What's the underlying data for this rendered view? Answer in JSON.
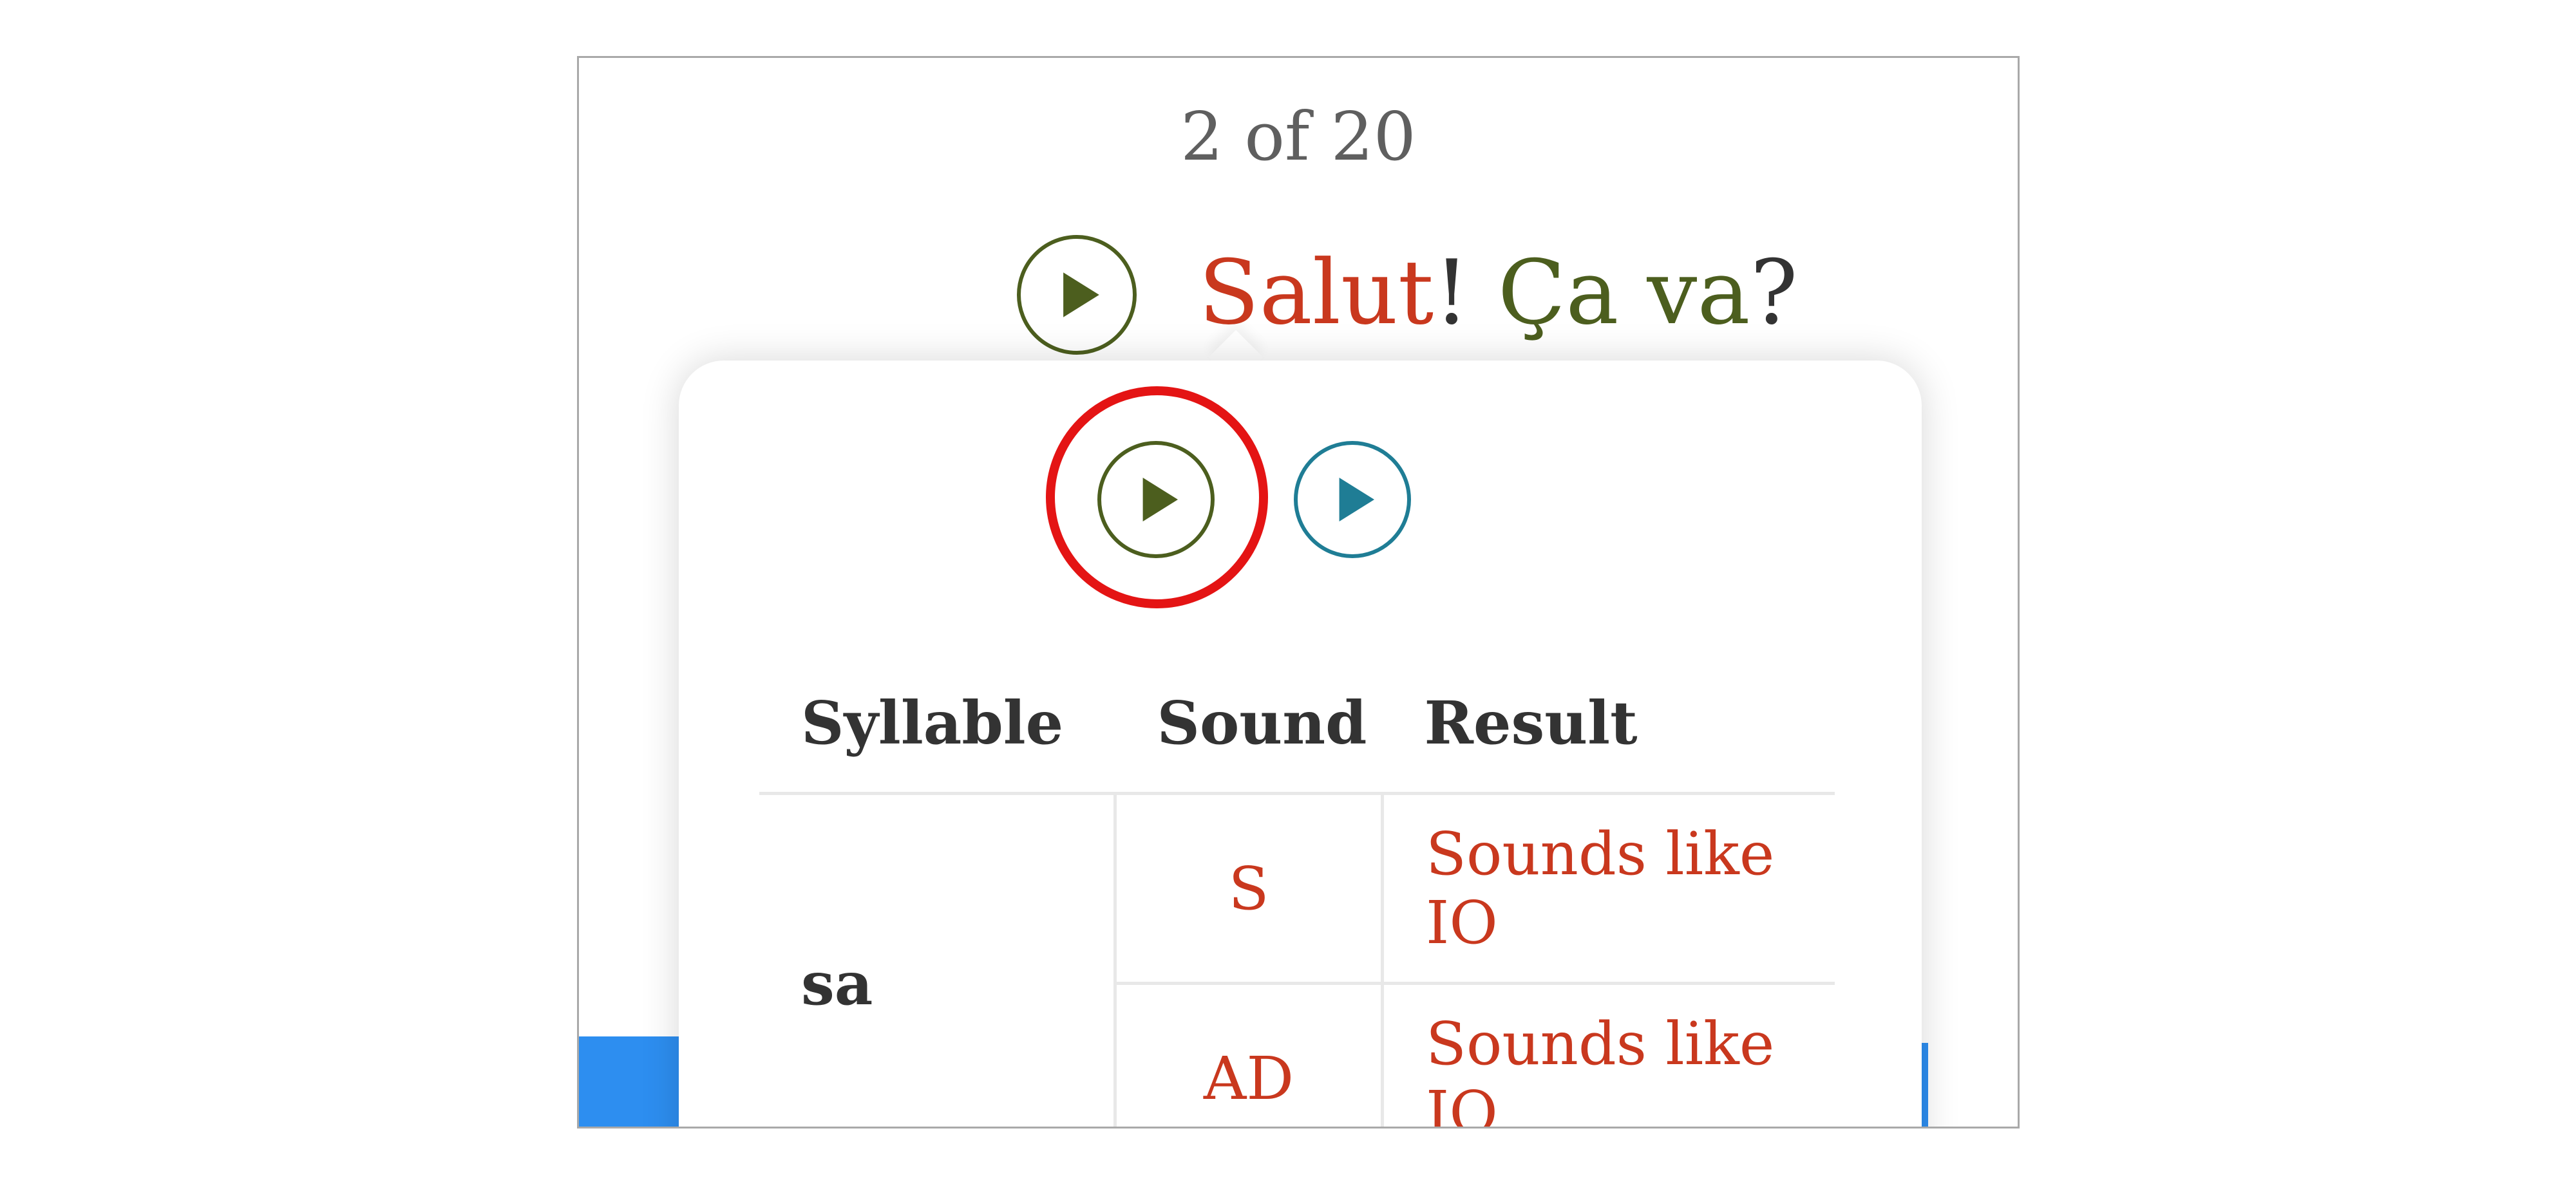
{
  "progress": {
    "current": 2,
    "total": 20,
    "label": "2 of 20"
  },
  "sentence": {
    "words": [
      "Salut",
      "!",
      "Ça va",
      "?"
    ]
  },
  "popup": {
    "table": {
      "headers": [
        "Syllable",
        "Sound",
        "Result"
      ],
      "rows": [
        {
          "syllable": "sa",
          "sound": "S",
          "result": "Sounds like IO"
        },
        {
          "syllable": "",
          "sound": "AD",
          "result": "Sounds like IO"
        }
      ]
    }
  },
  "icons": {
    "sentence_play": "play-icon",
    "word_native_play": "play-icon",
    "word_user_play": "play-icon"
  },
  "colors": {
    "error_red": "#c9381e",
    "success_green": "#4c5e1e",
    "user_audio_teal": "#1f7d95",
    "highlight_ring": "#e41414",
    "accent_blue": "#2d8ef0",
    "text_dark": "#333333",
    "text_gray": "#5f5f5f"
  }
}
